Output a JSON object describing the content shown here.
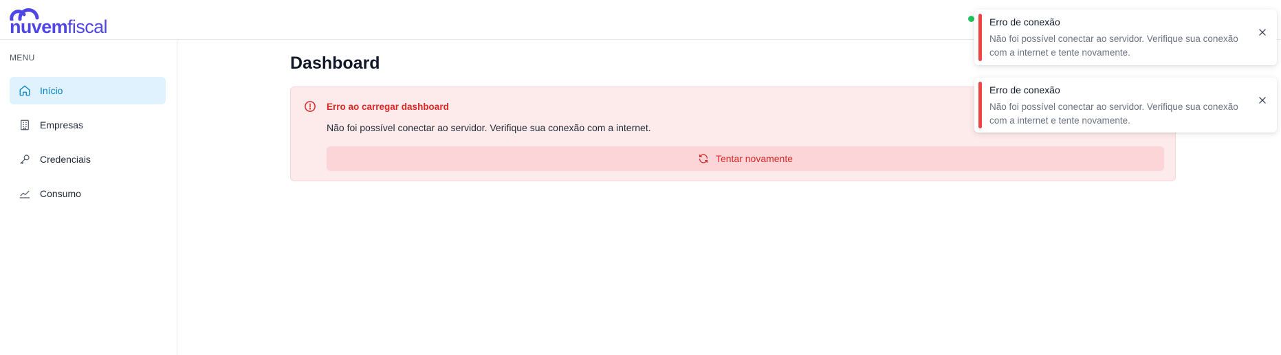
{
  "brand": {
    "name_bold": "nuvem",
    "name_regular": "fiscal",
    "accent_color": "#4f46e5"
  },
  "header": {
    "status_color": "#22c55e"
  },
  "sidebar": {
    "menu_label": "MENU",
    "items": [
      {
        "label": "Início",
        "icon": "home-icon",
        "active": true
      },
      {
        "label": "Empresas",
        "icon": "building-icon",
        "active": false
      },
      {
        "label": "Credenciais",
        "icon": "key-icon",
        "active": false
      },
      {
        "label": "Consumo",
        "icon": "chart-line-icon",
        "active": false
      }
    ]
  },
  "main": {
    "title": "Dashboard",
    "error": {
      "title": "Erro ao carregar dashboard",
      "message": "Não foi possível conectar ao servidor. Verifique sua conexão com a internet.",
      "retry_label": "Tentar novamente",
      "color": "#dc2626"
    }
  },
  "toasts": [
    {
      "title": "Erro de conexão",
      "message": "Não foi possível conectar ao servidor. Verifique sua conexão com a internet e tente novamente."
    },
    {
      "title": "Erro de conexão",
      "message": "Não foi possível conectar ao servidor. Verifique sua conexão com a internet e tente novamente."
    }
  ]
}
